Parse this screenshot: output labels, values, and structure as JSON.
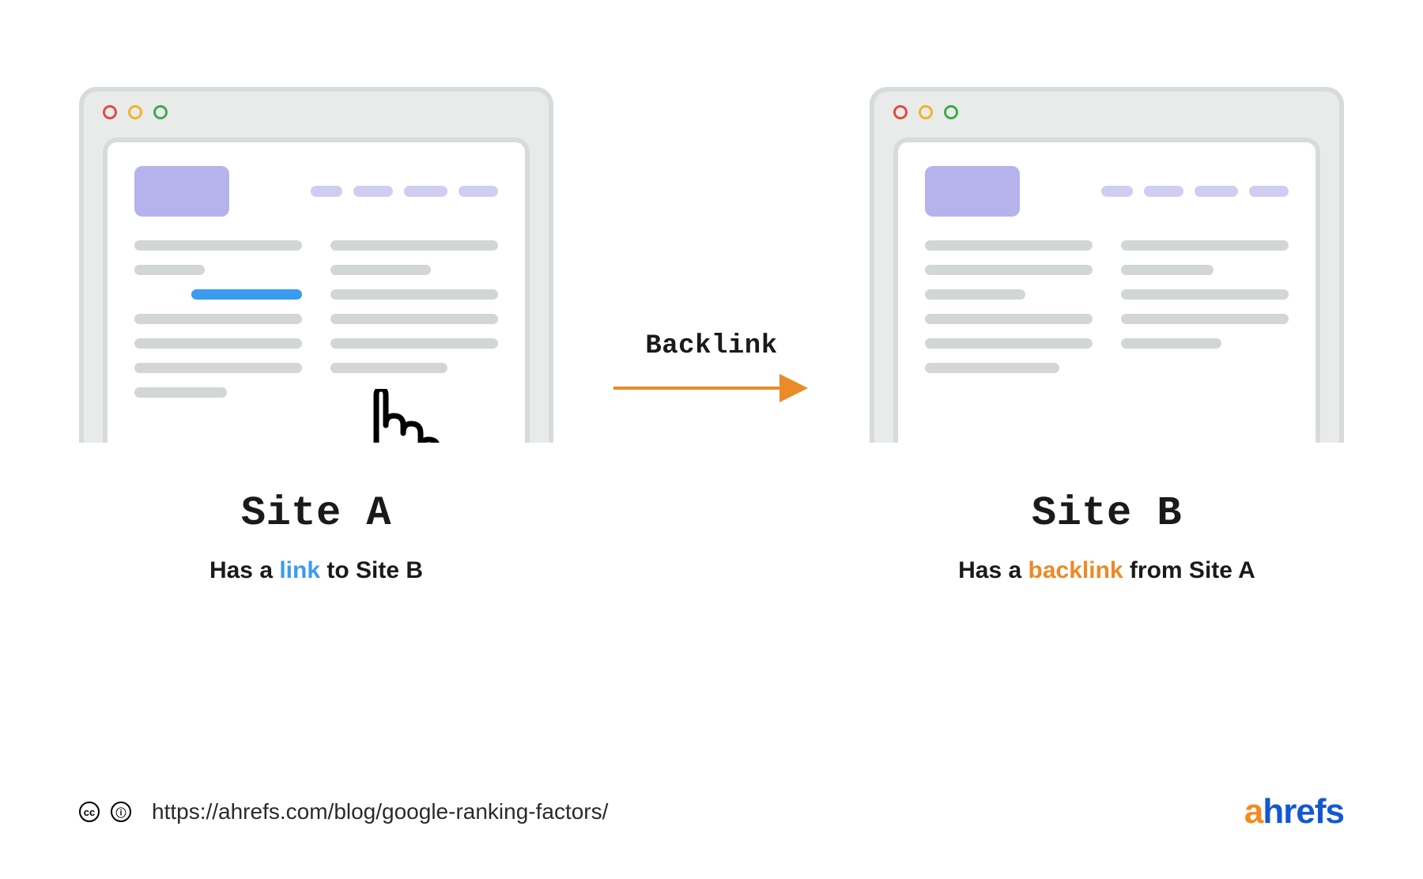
{
  "arrow": {
    "label": "Backlink",
    "color": "#eb8a28"
  },
  "siteA": {
    "title": "Site A",
    "caption_prefix": "Has a ",
    "caption_highlight": "link",
    "caption_suffix": " to Site B"
  },
  "siteB": {
    "title": "Site B",
    "caption_prefix": "Has a ",
    "caption_highlight": "backlink",
    "caption_suffix": " from Site A"
  },
  "footer": {
    "cc": "cc",
    "by_glyph": "ⓘ",
    "url": "https://ahrefs.com/blog/google-ranking-factors/"
  },
  "brand": {
    "a": "a",
    "rest": "hrefs"
  },
  "colors": {
    "link": "#3a9cf0",
    "backlink": "#eb8a28",
    "grey": "#d3d6d6",
    "lavender": "#b6b3ec"
  },
  "traffic_lights": [
    "red",
    "yellow",
    "green"
  ]
}
